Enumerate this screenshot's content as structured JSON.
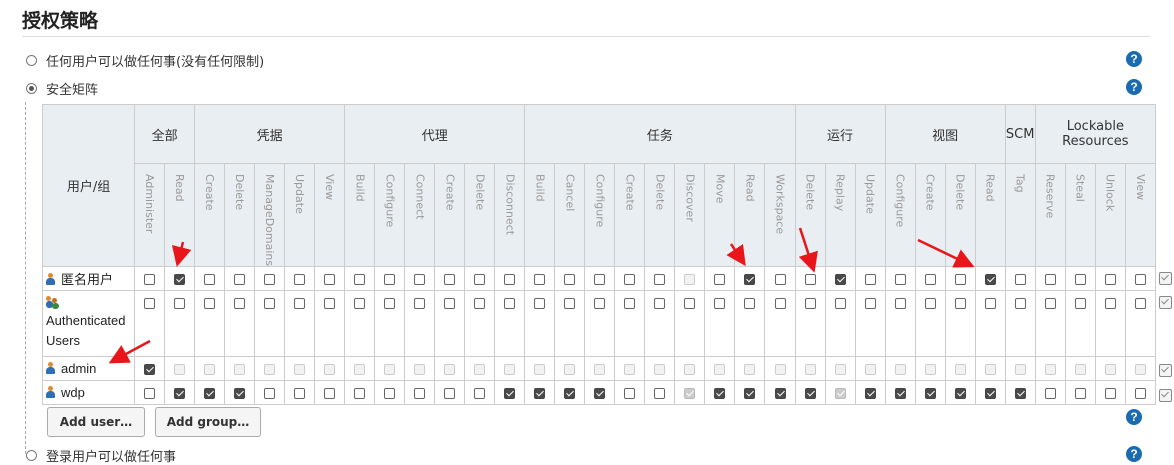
{
  "title": "授权策略",
  "options": [
    {
      "label": "任何用户可以做任何事(没有任何限制)",
      "selected": false
    },
    {
      "label": "安全矩阵",
      "selected": true
    },
    {
      "label": "登录用户可以做任何事",
      "selected": false
    }
  ],
  "help_glyph": "?",
  "matrix": {
    "user_header": "用户/组",
    "groups": [
      {
        "name": "全部",
        "span": 2
      },
      {
        "name": "凭据",
        "span": 5
      },
      {
        "name": "代理",
        "span": 6
      },
      {
        "name": "任务",
        "span": 9
      },
      {
        "name": "运行",
        "span": 3
      },
      {
        "name": "视图",
        "span": 4
      },
      {
        "name": "SCM",
        "span": 1
      },
      {
        "name": "Lockable Resources",
        "span": 4
      }
    ],
    "permissions": [
      "Administer",
      "Read",
      "Create",
      "Delete",
      "ManageDomains",
      "Update",
      "View",
      "Build",
      "Configure",
      "Connect",
      "Create",
      "Delete",
      "Disconnect",
      "Build",
      "Cancel",
      "Configure",
      "Create",
      "Delete",
      "Discover",
      "Move",
      "Read",
      "Workspace",
      "Delete",
      "Replay",
      "Update",
      "Configure",
      "Create",
      "Delete",
      "Read",
      "Tag",
      "Reserve",
      "Steal",
      "Unlock",
      "View"
    ],
    "rows": [
      {
        "name": "匿名用户",
        "type": "user",
        "checked": [
          1,
          20,
          23,
          28
        ],
        "disabled": [
          18
        ]
      },
      {
        "name": "Authenticated Users",
        "type": "group",
        "checked": [],
        "disabled": []
      },
      {
        "name": "admin",
        "type": "user",
        "checked": [
          0
        ],
        "disabled": [
          1,
          2,
          3,
          4,
          5,
          6,
          7,
          8,
          9,
          10,
          11,
          12,
          13,
          14,
          15,
          16,
          17,
          18,
          19,
          20,
          21,
          22,
          23,
          24,
          25,
          26,
          27,
          28,
          29,
          30,
          31,
          32,
          33
        ]
      },
      {
        "name": "wdp",
        "type": "user",
        "checked": [
          1,
          2,
          3,
          12,
          13,
          14,
          15,
          18,
          19,
          20,
          21,
          22,
          23,
          24,
          25,
          26,
          27,
          28,
          29
        ],
        "disabled": [
          18,
          23
        ]
      }
    ]
  },
  "buttons": {
    "add_user": "Add user…",
    "add_group": "Add group…"
  },
  "colors": {
    "help": "#1a6bb0",
    "arrow": "#e8161a",
    "header_bg": "#e9eef2"
  }
}
